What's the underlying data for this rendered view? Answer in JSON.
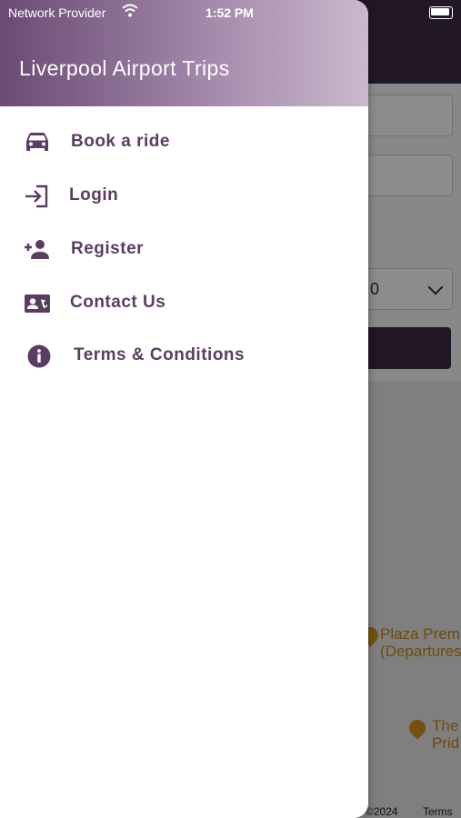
{
  "status_bar": {
    "carrier": "Network Provider",
    "time": "1:52 PM"
  },
  "drawer": {
    "title": "Liverpool Airport Trips",
    "items": [
      {
        "label": "Book a ride",
        "icon": "car-icon"
      },
      {
        "label": "Login",
        "icon": "login-icon"
      },
      {
        "label": "Register",
        "icon": "person-add-icon"
      },
      {
        "label": "Contact Us",
        "icon": "contact-card-icon"
      },
      {
        "label": "Terms & Conditions",
        "icon": "info-icon"
      }
    ]
  },
  "background": {
    "select_value": "0",
    "map": {
      "poi_1": [
        "Plaza Prem",
        "(Departures"
      ],
      "poi_2": [
        "The",
        "Prid"
      ],
      "footer_copy": "a ©2024",
      "footer_terms": "Terms"
    }
  },
  "colors": {
    "accent": "#5b3d63",
    "header_dark": "#3f2a44"
  }
}
